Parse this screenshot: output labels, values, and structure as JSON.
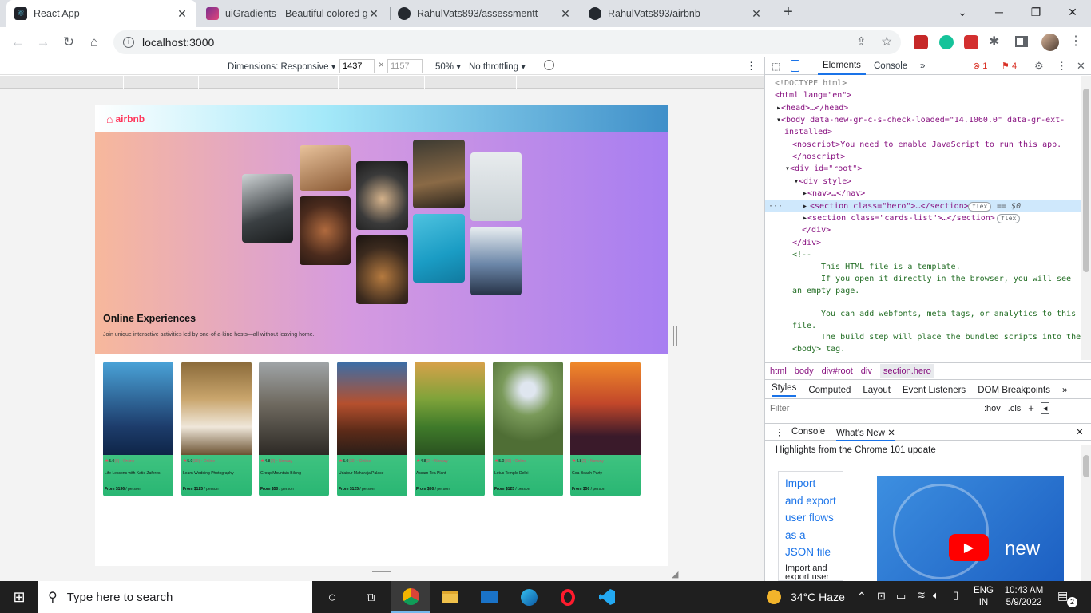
{
  "browser": {
    "tabs": [
      {
        "title": "React App",
        "active": true
      },
      {
        "title": "uiGradients - Beautiful colored gr"
      },
      {
        "title": "RahulVats893/assessmentt"
      },
      {
        "title": "RahulVats893/airbnb"
      }
    ],
    "new_tab": "+",
    "url": "localhost:3000"
  },
  "device_toolbar": {
    "dimensions_label": "Dimensions: Responsive",
    "width": "1437",
    "height": "1157",
    "times": "×",
    "zoom": "50%",
    "throttling": "No throttling"
  },
  "app": {
    "logo_text": "airbnb",
    "hero_title": "Online Experiences",
    "hero_subtitle": "Join unique interactive activities led by one-of-a-kind hosts—all without leaving home.",
    "cards": [
      {
        "rating": "5.0",
        "count": "(6) • Online",
        "title": "Life Lessons with Katie Zaferes",
        "price": "From $136",
        "unit": " / person"
      },
      {
        "rating": "5.0",
        "count": "(30) • Online",
        "title": "Learn Wedding Photography",
        "price": "From $125",
        "unit": " / person"
      },
      {
        "rating": "4.8",
        "count": "(2) • Norway",
        "title": "Group Mountain Biking",
        "price": "From $50",
        "unit": " / person"
      },
      {
        "rating": "5.0",
        "count": "(30) • Online",
        "title": "Udaipur Maharaja Palace",
        "price": "From $125",
        "unit": " / person"
      },
      {
        "rating": "4.8",
        "count": "(2) • Norway",
        "title": "Assam Tea Plant",
        "price": "From $50",
        "unit": " / person"
      },
      {
        "rating": "5.0",
        "count": "(30) • Online",
        "title": "Lotus Temple Delhi",
        "price": "From $125",
        "unit": " / person"
      },
      {
        "rating": "4.8",
        "count": "(2) • Norway",
        "title": "Goa Beach Party",
        "price": "From $50",
        "unit": " / person"
      }
    ]
  },
  "devtools": {
    "tabs": [
      "Elements",
      "Console"
    ],
    "more": "»",
    "errors": "1",
    "warnings": "4",
    "dom_lines": [
      "<!DOCTYPE html>",
      "<html lang=\"en\">",
      "<head>…</head>",
      "<body data-new-gr-c-s-check-loaded=\"14.1060.0\" data-gr-ext-",
      "installed>",
      "<noscript>You need to enable JavaScript to run this app.",
      "</noscript>",
      "<div id=\"root\">",
      "<div style>",
      "<nav>…</nav>",
      "<section class=\"hero\">…</section>",
      "flex",
      "== $0",
      "<section class=\"cards-list\">…</section>",
      "flex",
      "</div>",
      "</div>",
      "<!--",
      "This HTML file is a template.",
      "If you open it directly in the browser, you will see",
      "an empty page.",
      "You can add webfonts, meta tags, or analytics to this",
      "file.",
      "The build step will place the bundled scripts into the",
      "<body> tag."
    ],
    "breadcrumbs": [
      "html",
      "body",
      "div#root",
      "div",
      "section.hero"
    ],
    "styles_tabs": [
      "Styles",
      "Computed",
      "Layout",
      "Event Listeners",
      "DOM Breakpoints",
      "»"
    ],
    "filter_placeholder": "Filter",
    "hov": ":hov",
    "cls": ".cls",
    "drawer_tabs": [
      "Console",
      "What's New"
    ],
    "whats_new_heading": "Highlights from the Chrome 101 update",
    "whats_new_link": "Import and export user flows as a JSON file",
    "whats_new_desc": "Import and export user flows as a JSON file in",
    "video_text": "new"
  },
  "taskbar": {
    "search_placeholder": "Type here to search",
    "weather": "34°C  Haze",
    "lang1": "ENG",
    "lang2": "IN",
    "time": "10:43 AM",
    "date": "5/9/2022",
    "notifications": "2"
  },
  "colors": {
    "accent": "#1a73e8",
    "airbnb": "#ff385c"
  }
}
